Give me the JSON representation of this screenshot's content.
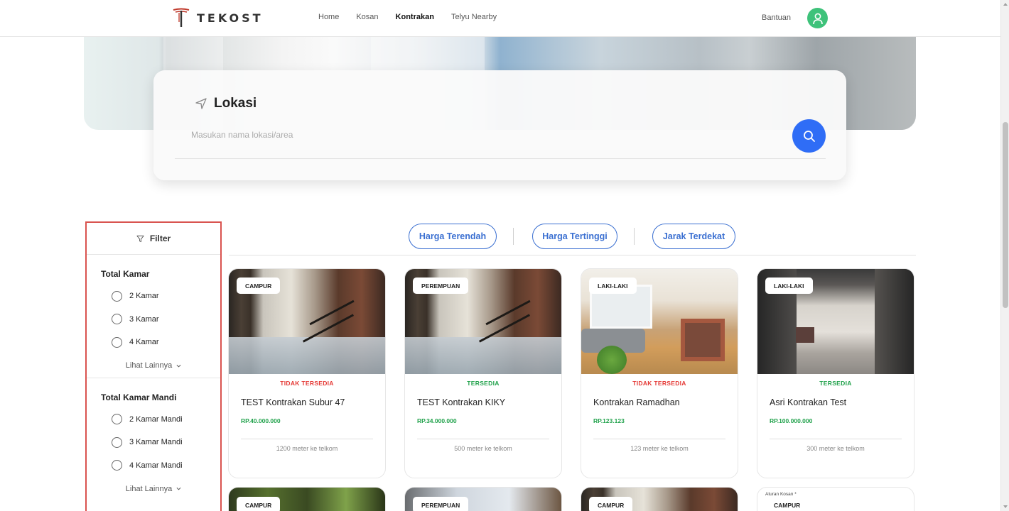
{
  "nav": {
    "brand": "TEKOST",
    "links": [
      "Home",
      "Kosan",
      "Kontrakan",
      "Telyu Nearby"
    ],
    "active_link": "Kontrakan",
    "help": "Bantuan"
  },
  "search": {
    "title": "Lokasi",
    "placeholder": "Masukan nama lokasi/area"
  },
  "filter": {
    "title": "Filter",
    "groups": [
      {
        "title": "Total Kamar",
        "options": [
          "2 Kamar",
          "3 Kamar",
          "4 Kamar"
        ],
        "more": "Lihat Lainnya"
      },
      {
        "title": "Total Kamar Mandi",
        "options": [
          "2 Kamar Mandi",
          "3 Kamar Mandi",
          "4 Kamar Mandi"
        ],
        "more": "Lihat Lainnya"
      }
    ]
  },
  "sort": [
    "Harga Terendah",
    "Harga Tertinggi",
    "Jarak Terdekat"
  ],
  "listings": [
    {
      "badge": "CAMPUR",
      "status": "TIDAK TERSEDIA",
      "title": "TEST Kontrakan Subur 47",
      "price": "RP.40.000.000",
      "distance": "1200 meter ke telkom"
    },
    {
      "badge": "PEREMPUAN",
      "status": "TERSEDIA",
      "title": "TEST Kontrakan KIKY",
      "price": "RP.34.000.000",
      "distance": "500 meter ke telkom"
    },
    {
      "badge": "LAKI-LAKI",
      "status": "TIDAK TERSEDIA",
      "title": "Kontrakan Ramadhan",
      "price": "RP.123.123",
      "distance": "123 meter ke telkom"
    },
    {
      "badge": "LAKI-LAKI",
      "status": "TERSEDIA",
      "title": "Asri Kontrakan Test",
      "price": "RP.100.000.000",
      "distance": "300 meter ke telkom"
    }
  ],
  "next_row": [
    {
      "badge": "CAMPUR"
    },
    {
      "badge": "PEREMPUAN"
    },
    {
      "badge": "CAMPUR"
    },
    {
      "badge": "CAMPUR",
      "note": "Aturan Kosan *"
    }
  ],
  "colors": {
    "accent": "#2f6df6",
    "available": "#1fa14a",
    "unavailable": "#e53935",
    "filter_border": "#d9534f",
    "avatar": "#3ec27a"
  }
}
